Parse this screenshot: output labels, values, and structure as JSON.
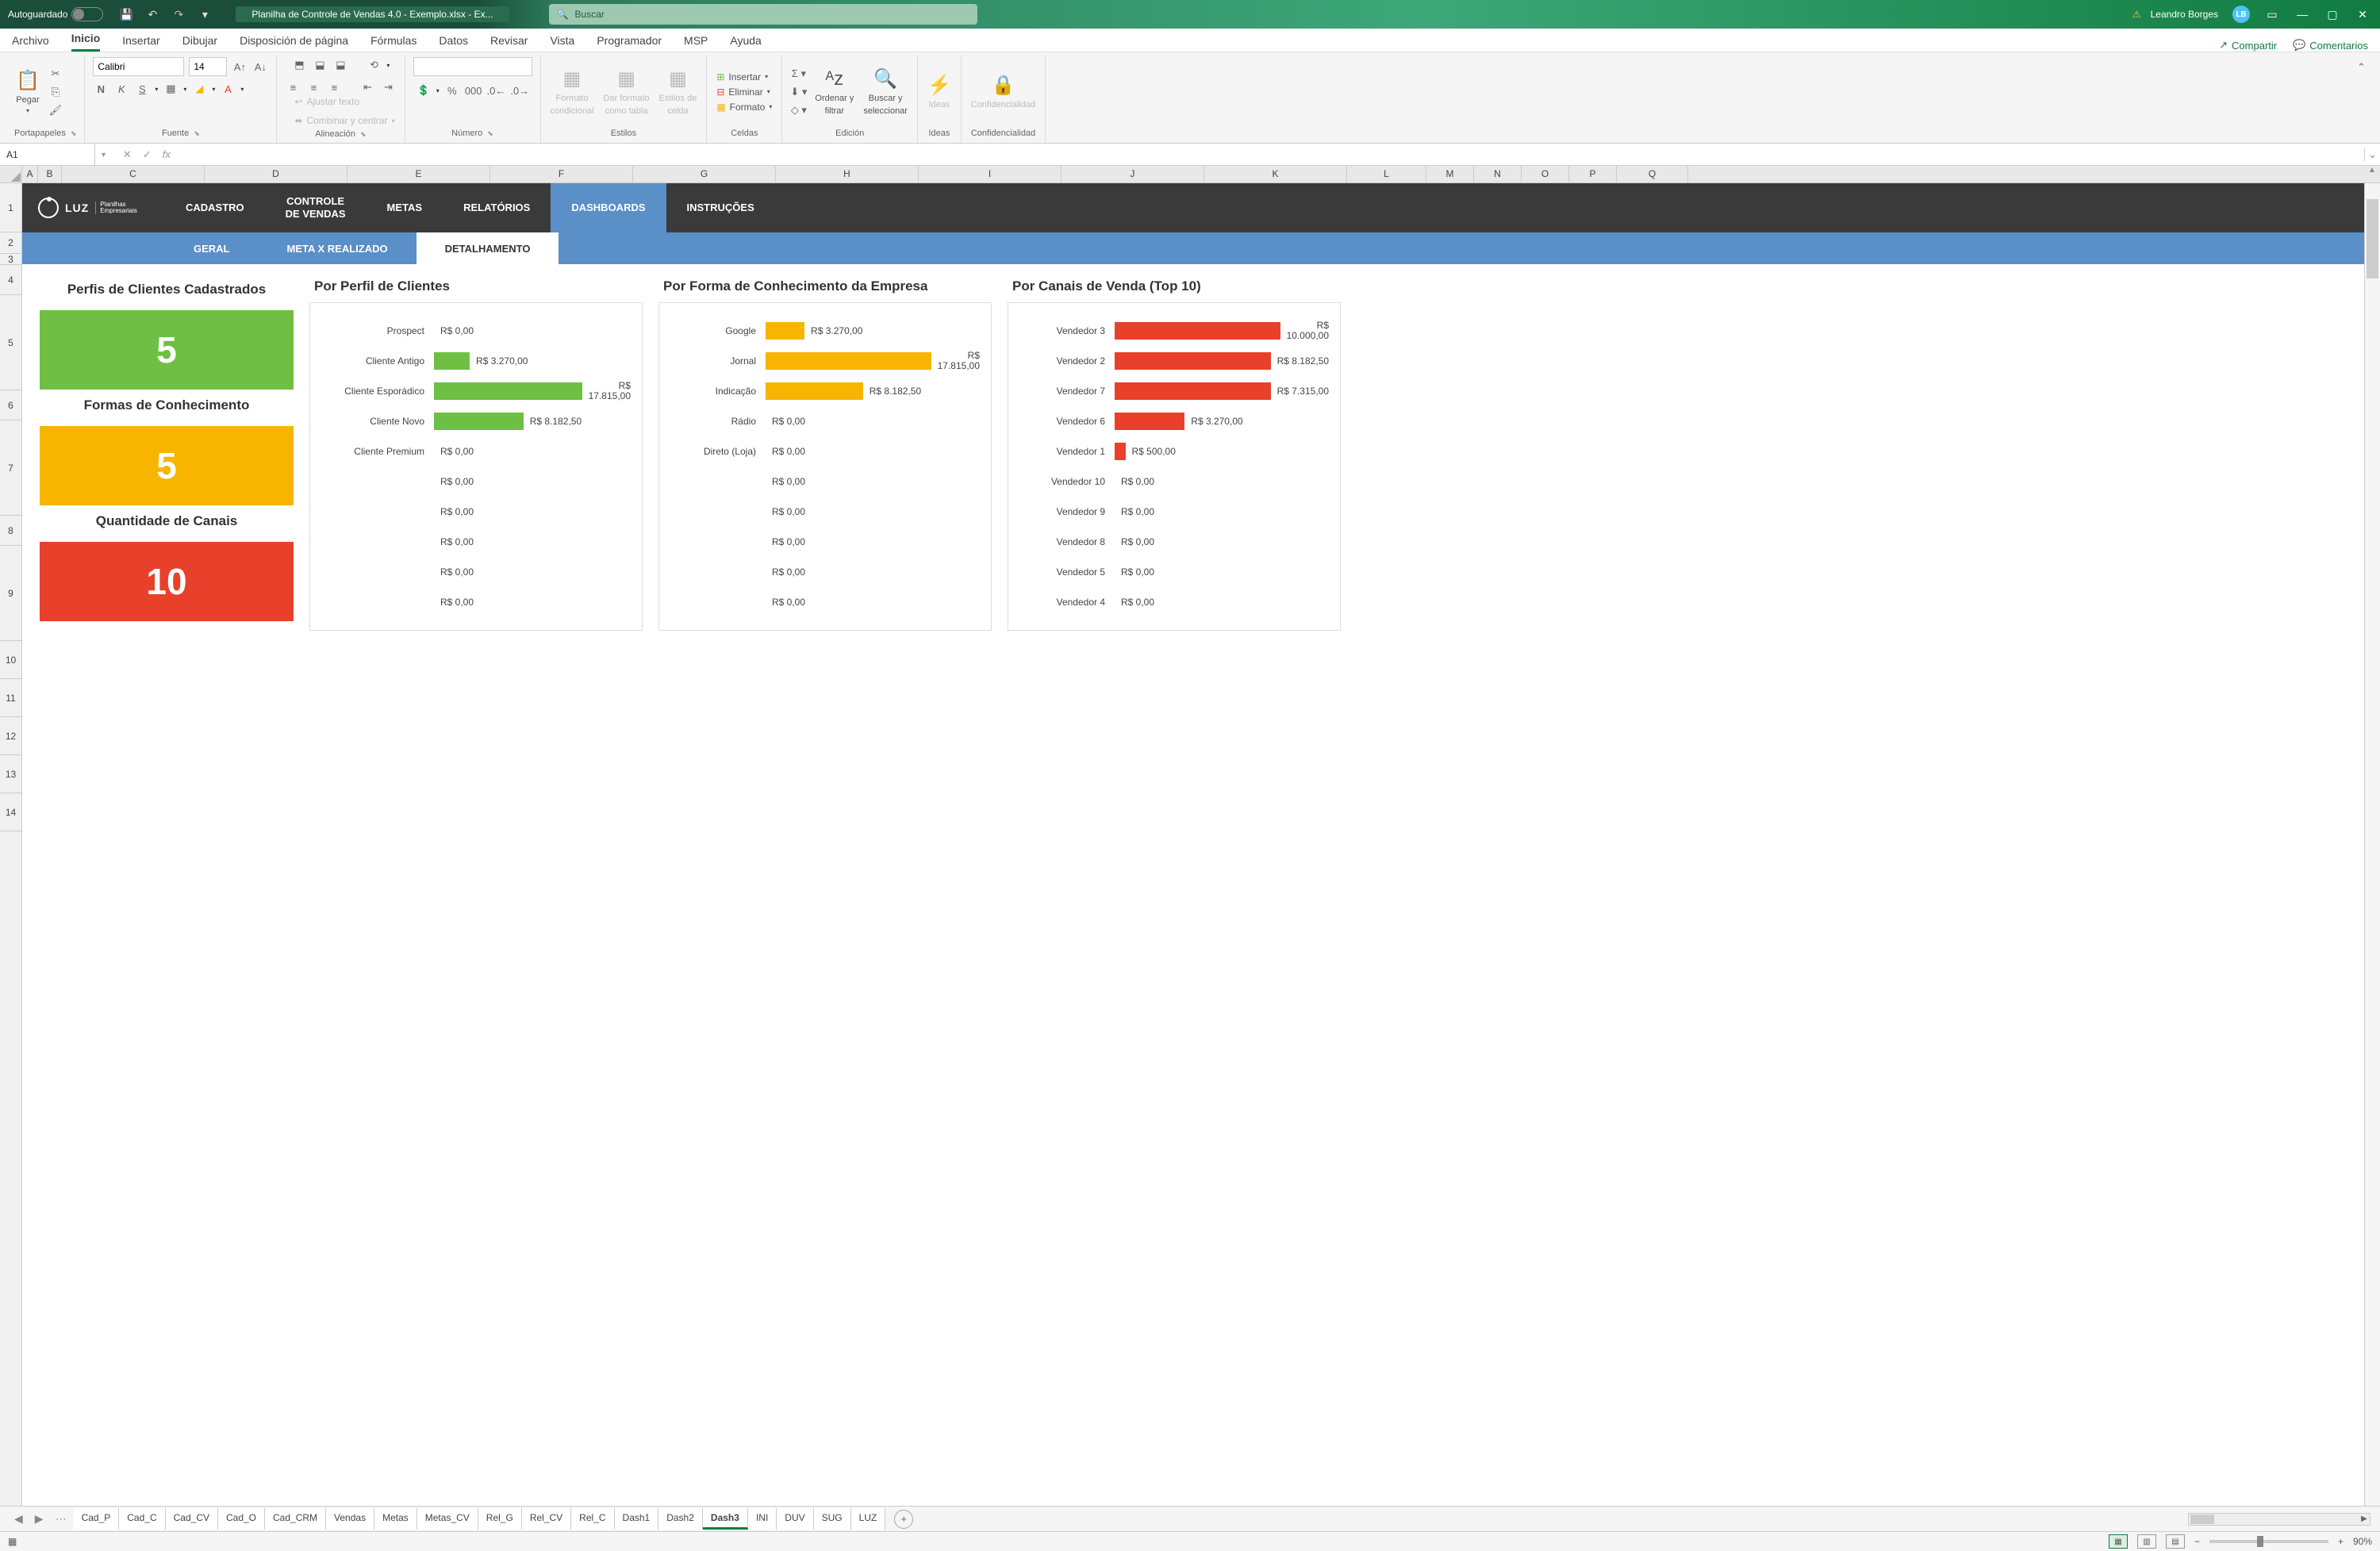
{
  "titlebar": {
    "autosave": "Autoguardado",
    "filename": "Planilha de Controle de Vendas 4.0 - Exemplo.xlsx  -  Ex...",
    "search_placeholder": "Buscar",
    "user": "Leandro Borges",
    "user_initials": "LB"
  },
  "menutabs": {
    "items": [
      "Archivo",
      "Inicio",
      "Insertar",
      "Dibujar",
      "Disposición de página",
      "Fórmulas",
      "Datos",
      "Revisar",
      "Vista",
      "Programador",
      "MSP",
      "Ayuda"
    ],
    "active": "Inicio",
    "share": "Compartir",
    "comments": "Comentarios"
  },
  "ribbon": {
    "clipboard": {
      "paste": "Pegar",
      "label": "Portapapeles"
    },
    "font": {
      "name": "Calibri",
      "size": "14",
      "bold": "N",
      "italic": "K",
      "underline": "S",
      "label": "Fuente"
    },
    "align": {
      "wrap": "Ajustar texto",
      "merge": "Combinar y centrar",
      "label": "Alineación"
    },
    "number": {
      "label": "Número"
    },
    "styles": {
      "cond": "Formato",
      "cond2": "condicional",
      "table": "Dar formato",
      "table2": "como tabla",
      "cell": "Estilos de",
      "cell2": "celda",
      "label": "Estilos"
    },
    "cells": {
      "insert": "Insertar",
      "delete": "Eliminar",
      "format": "Formato",
      "label": "Celdas"
    },
    "editing": {
      "sort": "Ordenar y",
      "sort2": "filtrar",
      "find": "Buscar y",
      "find2": "seleccionar",
      "label": "Edición"
    },
    "ideas": {
      "btn": "Ideas",
      "label": "Ideas"
    },
    "conf": {
      "btn": "Confidencialidad",
      "label": "Confidencialidad"
    }
  },
  "formulabar": {
    "cell": "A1",
    "fx": "fx"
  },
  "columns": [
    "A",
    "B",
    "C",
    "D",
    "E",
    "F",
    "G",
    "H",
    "I",
    "J",
    "K",
    "L",
    "M",
    "N",
    "O",
    "P",
    "Q"
  ],
  "rows": [
    "1",
    "2",
    "3",
    "4",
    "5",
    "6",
    "7",
    "8",
    "9",
    "10",
    "11",
    "12",
    "13",
    "14"
  ],
  "dash": {
    "logo": "LUZ",
    "logo_sub": "Planilhas\nEmpresariais",
    "tabs": [
      "CADASTRO",
      "CONTROLE\nDE VENDAS",
      "METAS",
      "RELATÓRIOS",
      "DASHBOARDS",
      "INSTRUÇÕES"
    ],
    "tabs_active": "DASHBOARDS",
    "subtabs": [
      "GERAL",
      "META X REALIZADO",
      "DETALHAMENTO"
    ],
    "subtabs_active": "DETALHAMENTO"
  },
  "kpis": {
    "t1": "Perfis de Clientes Cadastrados",
    "v1": "5",
    "t2": "Formas de Conhecimento",
    "v2": "5",
    "t3": "Quantidade de Canais",
    "v3": "10"
  },
  "charts": {
    "perfil_title": "Por Perfil de Clientes",
    "conhec_title": "Por Forma de Conhecimento da Empresa",
    "canais_title": "Por Canais de Venda (Top 10)"
  },
  "chart_data": {
    "perfil": {
      "type": "bar",
      "orientation": "horizontal",
      "xlim": [
        0,
        18000
      ],
      "currency": "R$",
      "categories": [
        "Prospect",
        "Cliente Antigo",
        "Cliente Esporádico",
        "Cliente Novo",
        "Cliente Premium",
        "",
        "",
        "",
        "",
        ""
      ],
      "values": [
        0,
        3270,
        17815,
        8182.5,
        0,
        0,
        0,
        0,
        0,
        0
      ],
      "value_labels": [
        "R$ 0,00",
        "R$ 3.270,00",
        "R$ 17.815,00",
        "R$ 8.182,50",
        "R$ 0,00",
        "R$ 0,00",
        "R$ 0,00",
        "R$ 0,00",
        "R$ 0,00",
        "R$ 0,00"
      ],
      "color": "#6fbf44"
    },
    "conhecimento": {
      "type": "bar",
      "orientation": "horizontal",
      "xlim": [
        0,
        18000
      ],
      "currency": "R$",
      "categories": [
        "Google",
        "Jornal",
        "Indicação",
        "Rádio",
        "Direto (Loja)",
        "",
        "",
        "",
        "",
        ""
      ],
      "values": [
        3270,
        17815,
        8182.5,
        0,
        0,
        0,
        0,
        0,
        0,
        0
      ],
      "value_labels": [
        "R$ 3.270,00",
        "R$ 17.815,00",
        "R$ 8.182,50",
        "R$ 0,00",
        "R$ 0,00",
        "R$ 0,00",
        "R$ 0,00",
        "R$ 0,00",
        "R$ 0,00",
        "R$ 0,00"
      ],
      "color": "#f7b500"
    },
    "canais": {
      "type": "bar",
      "orientation": "horizontal",
      "xlim": [
        0,
        10000
      ],
      "currency": "R$",
      "categories": [
        "Vendedor 3",
        "Vendedor 2",
        "Vendedor 7",
        "Vendedor 6",
        "Vendedor 1",
        "Vendedor 10",
        "Vendedor 9",
        "Vendedor 8",
        "Vendedor 5",
        "Vendedor 4"
      ],
      "values": [
        10000,
        8182.5,
        7315,
        3270,
        500,
        0,
        0,
        0,
        0,
        0
      ],
      "value_labels": [
        "R$ 10.000,00",
        "R$ 8.182,50",
        "R$ 7.315,00",
        "R$ 3.270,00",
        "R$ 500,00",
        "R$ 0,00",
        "R$ 0,00",
        "R$ 0,00",
        "R$ 0,00",
        "R$ 0,00"
      ],
      "color": "#e8402a"
    }
  },
  "sheettabs": {
    "items": [
      "Cad_P",
      "Cad_C",
      "Cad_CV",
      "Cad_O",
      "Cad_CRM",
      "Vendas",
      "Metas",
      "Metas_CV",
      "Rel_G",
      "Rel_CV",
      "Rel_C",
      "Dash1",
      "Dash2",
      "Dash3",
      "INI",
      "DUV",
      "SUG",
      "LUZ"
    ],
    "active": "Dash3"
  },
  "statusbar": {
    "ready": "",
    "zoom": "90%"
  }
}
